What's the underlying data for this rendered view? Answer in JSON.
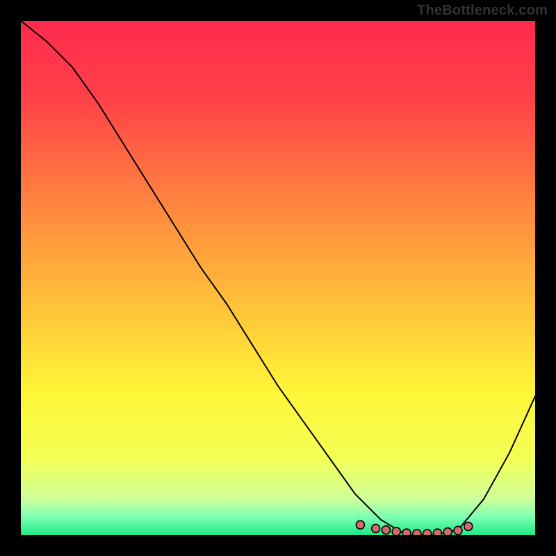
{
  "watermark": "TheBottleneck.com",
  "chart_data": {
    "type": "line",
    "title": "",
    "xlabel": "",
    "ylabel": "",
    "xlim": [
      0,
      1
    ],
    "ylim": [
      0,
      1
    ],
    "grid": false,
    "series": [
      {
        "name": "bottleneck-curve",
        "x": [
          0.0,
          0.05,
          0.1,
          0.15,
          0.2,
          0.25,
          0.3,
          0.35,
          0.4,
          0.45,
          0.5,
          0.55,
          0.6,
          0.65,
          0.7,
          0.75,
          0.8,
          0.85,
          0.9,
          0.95,
          1.0
        ],
        "y": [
          1.0,
          0.96,
          0.91,
          0.84,
          0.76,
          0.68,
          0.6,
          0.52,
          0.45,
          0.37,
          0.29,
          0.22,
          0.15,
          0.08,
          0.03,
          0.0,
          0.0,
          0.01,
          0.07,
          0.16,
          0.27
        ]
      }
    ],
    "markers": {
      "name": "optimal-range",
      "x": [
        0.66,
        0.69,
        0.71,
        0.73,
        0.75,
        0.77,
        0.79,
        0.81,
        0.83,
        0.85,
        0.87
      ],
      "y": [
        0.02,
        0.013,
        0.01,
        0.007,
        0.004,
        0.003,
        0.003,
        0.004,
        0.006,
        0.009,
        0.017
      ]
    },
    "background": {
      "type": "vertical-gradient",
      "stops": [
        {
          "offset": 0.0,
          "color": "#ff2a4d"
        },
        {
          "offset": 0.15,
          "color": "#ff4148"
        },
        {
          "offset": 0.35,
          "color": "#ff833f"
        },
        {
          "offset": 0.55,
          "color": "#ffc13a"
        },
        {
          "offset": 0.72,
          "color": "#fff537"
        },
        {
          "offset": 0.85,
          "color": "#f4ff55"
        },
        {
          "offset": 0.93,
          "color": "#cfff9a"
        },
        {
          "offset": 0.965,
          "color": "#7cffb3"
        },
        {
          "offset": 1.0,
          "color": "#1de986"
        }
      ]
    }
  }
}
